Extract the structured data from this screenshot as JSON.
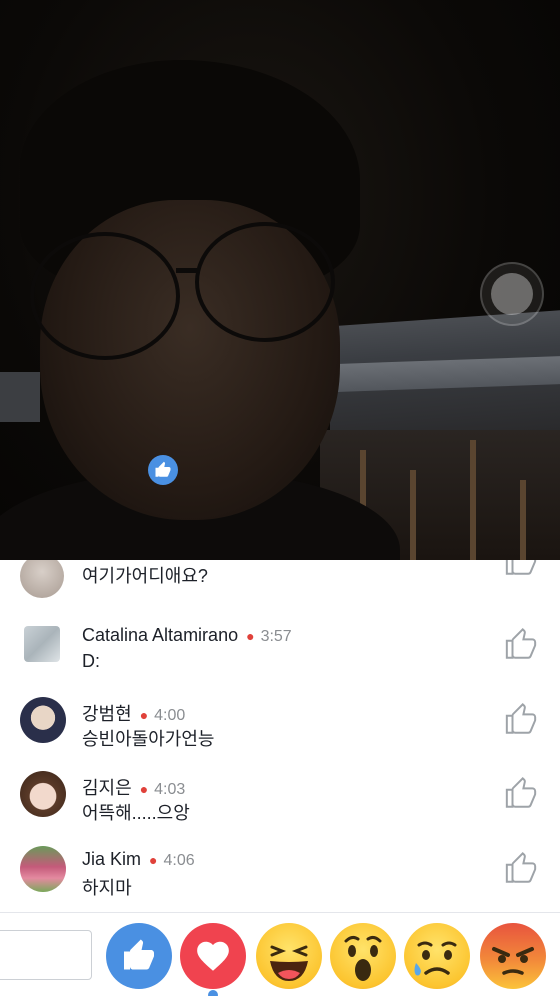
{
  "comments": [
    {
      "name": "",
      "time": "",
      "text": "여기가어디애요?",
      "avatar": "avatar-partial"
    },
    {
      "name": "Catalina Altamirano",
      "time": "3:57",
      "text": "D:",
      "avatar": "avatar-square-photo"
    },
    {
      "name": "강범현",
      "time": "4:00",
      "text": "승빈아돌아가언능",
      "avatar": "avatar-boy"
    },
    {
      "name": "김지은",
      "time": "4:03",
      "text": "어뜩해.....으앙",
      "avatar": "avatar-girl"
    },
    {
      "name": "Jia  Kim",
      "time": "4:06",
      "text": "하지마",
      "avatar": "avatar-flowers"
    }
  ],
  "icons": {
    "like_button": "thumbs-up-icon",
    "floating_reaction": "thumbs-up-icon",
    "record": "record-icon"
  },
  "colors": {
    "like_blue": "#4a90e2",
    "love_red": "#f0434f",
    "live_dot": "#e0413a"
  },
  "reactions": [
    "like",
    "love",
    "haha",
    "wow",
    "sad",
    "angry"
  ]
}
